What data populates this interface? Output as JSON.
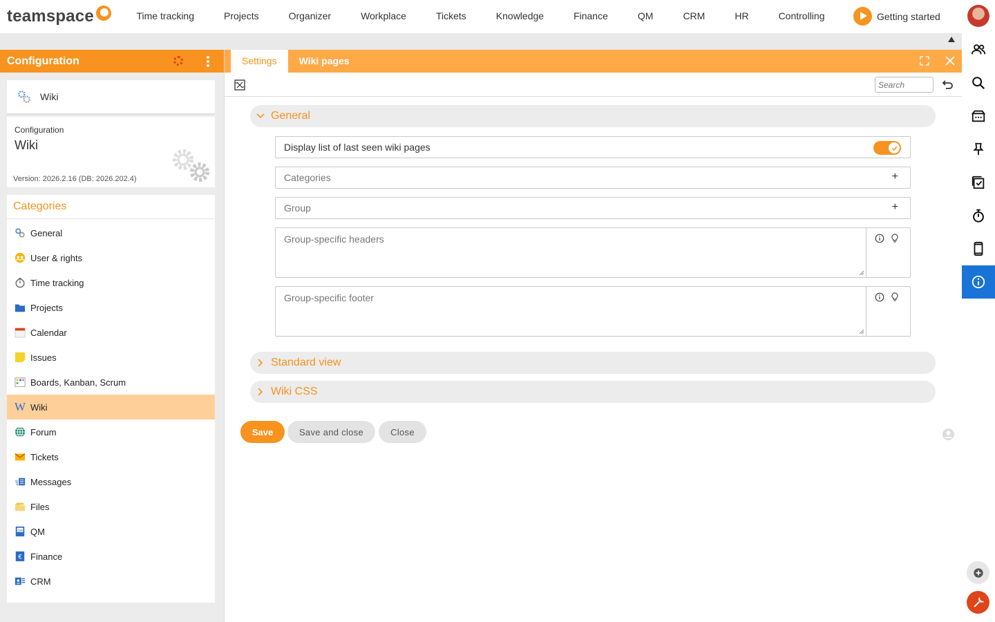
{
  "brand": {
    "name": "teamspace"
  },
  "topnav": {
    "items": [
      "Time tracking",
      "Projects",
      "Organizer",
      "Workplace",
      "Tickets",
      "Knowledge",
      "Finance",
      "QM",
      "CRM",
      "HR",
      "Controlling"
    ],
    "getting_started": "Getting started"
  },
  "left_panel": {
    "title": "Configuration",
    "wiki_card": {
      "label": "Wiki"
    },
    "config_card": {
      "label": "Configuration",
      "title": "Wiki",
      "version": "Version: 2026.2.16 (DB: 2026.202.4)"
    },
    "categories": {
      "heading": "Categories",
      "items": [
        {
          "label": "General",
          "icon": "gears-icon"
        },
        {
          "label": "User & rights",
          "icon": "users-icon"
        },
        {
          "label": "Time tracking",
          "icon": "stopwatch-icon"
        },
        {
          "label": "Projects",
          "icon": "folder-icon"
        },
        {
          "label": "Calendar",
          "icon": "calendar-icon"
        },
        {
          "label": "Issues",
          "icon": "sticky-note-icon"
        },
        {
          "label": "Boards, Kanban, Scrum",
          "icon": "board-icon"
        },
        {
          "label": "Wiki",
          "icon": "wiki-icon",
          "selected": true
        },
        {
          "label": "Forum",
          "icon": "globe-icon"
        },
        {
          "label": "Tickets",
          "icon": "ticket-icon"
        },
        {
          "label": "Messages",
          "icon": "messages-icon"
        },
        {
          "label": "Files",
          "icon": "files-icon"
        },
        {
          "label": "QM",
          "icon": "qm-icon"
        },
        {
          "label": "Finance",
          "icon": "euro-icon"
        },
        {
          "label": "CRM",
          "icon": "contact-card-icon"
        }
      ]
    }
  },
  "main": {
    "tabs": [
      {
        "label": "Settings",
        "active": true
      },
      {
        "label": "Wiki pages",
        "active": false
      }
    ],
    "search": {
      "placeholder": "Search"
    },
    "sections": {
      "general": "General",
      "standard_view": "Standard view",
      "wiki_css": "Wiki CSS"
    },
    "fields": {
      "last_seen": {
        "label": "Display list of last seen wiki pages",
        "enabled": true
      },
      "categories": "Categories",
      "group": "Group",
      "group_headers": "Group-specific headers",
      "group_footer": "Group-specific footer"
    },
    "buttons": {
      "save": "Save",
      "save_and_close": "Save and close",
      "close": "Close"
    }
  },
  "colors": {
    "accent": "#f7931e",
    "accent_light": "#ffa947",
    "selected_row": "#ffcf9a",
    "info_active": "#1a73d8",
    "tool_red": "#e0441a"
  }
}
